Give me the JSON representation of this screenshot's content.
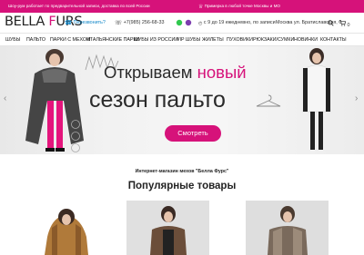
{
  "topbar": {
    "left_text": "Шоу-рум работает по предварительной записи, доставка по всей России",
    "right_text": "Примерка в любой точке Москвы и МО"
  },
  "header": {
    "logo_part1": "BELLA ",
    "logo_part2": "F",
    "logo_part3": "URS",
    "callback": "Перезвонить?",
    "phone": "+7(985) 256-68-33",
    "hours": "с 9 до 19 ежедневно, по записи",
    "address": "Москва ул. Братиславская, 6",
    "cart_count": "0"
  },
  "nav": {
    "items": [
      "ШУБЫ",
      "ПАЛЬТО",
      "ПАРКИ С МЕХОМ",
      "ИТАЛЬЯНСКИЕ ПАРКИ",
      "ШУБЫ ИЗ РОССИИ",
      "VIP ШУБЫ",
      "ЖИЛЕТЫ",
      "ПУХОВИКИ",
      "РЮКЗАКИ/СУМКИ",
      "НОВИНКИ",
      "КОНТАКТЫ"
    ]
  },
  "hero": {
    "headline_part1": "Открываем ",
    "headline_part2": "новый",
    "headline_line2": "сезон пальто",
    "cta": "Смотреть",
    "prev": "‹",
    "next": "›"
  },
  "intro": {
    "subtitle": "Интернет-магазин мехов \"Белла Фурс\""
  },
  "section": {
    "title": "Популярные товары"
  },
  "colors": {
    "accent": "#d6127a"
  },
  "icons": [
    "fur-icon",
    "phone-icon",
    "whatsapp-icon",
    "viber-icon",
    "location-icon",
    "search-icon",
    "cart-icon"
  ]
}
